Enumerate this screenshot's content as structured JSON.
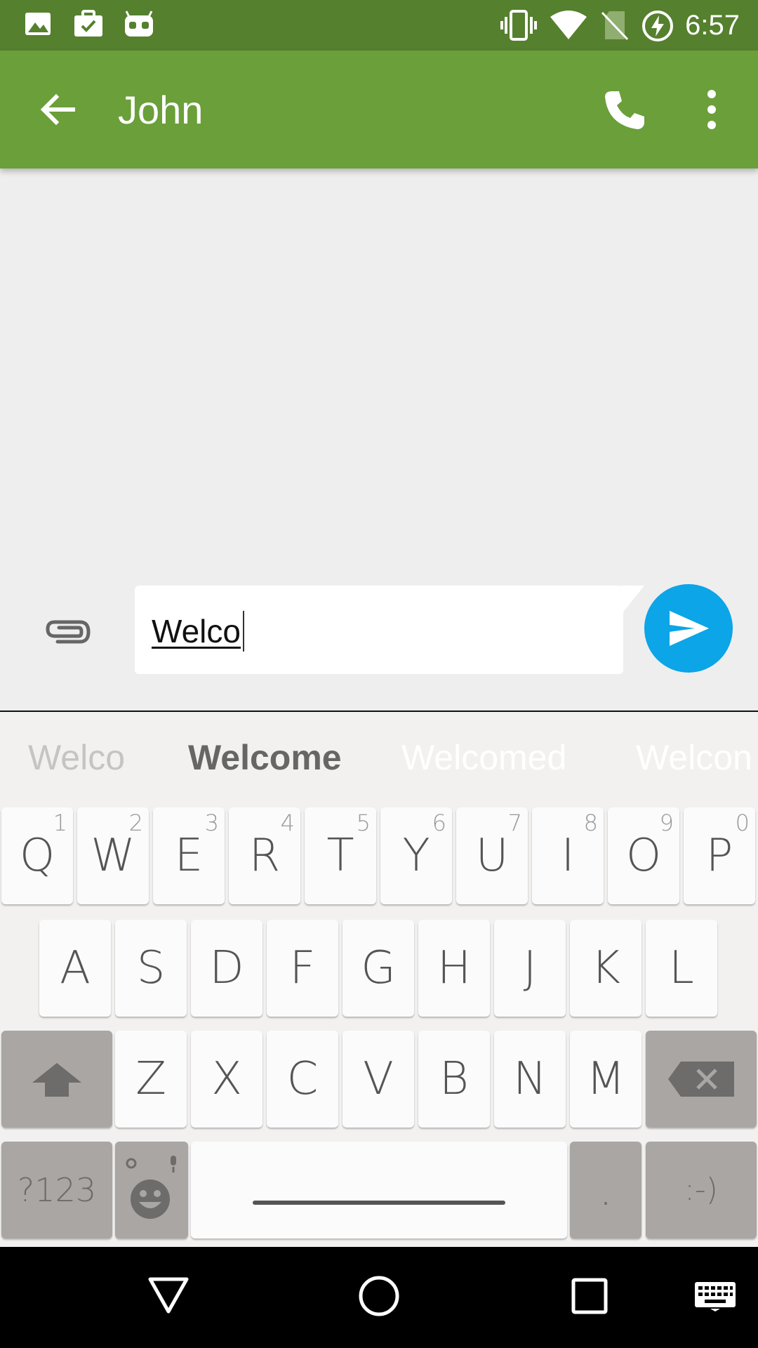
{
  "status_bar": {
    "time": "6:57",
    "left_icons": [
      "image-icon",
      "briefcase-check-icon",
      "cyanogen-icon"
    ],
    "right_icons": [
      "vibrate-icon",
      "wifi-icon",
      "no-sim-icon",
      "battery-charging-icon"
    ]
  },
  "app_bar": {
    "title": "John",
    "back_icon": "arrow-back-icon",
    "call_icon": "phone-icon",
    "more_icon": "more-vert-icon",
    "color": "#6a9f3a"
  },
  "compose": {
    "text": "Welco",
    "attach_icon": "paperclip-icon",
    "send_icon": "send-icon",
    "send_color": "#0ba5e8"
  },
  "keyboard": {
    "suggestions": [
      "Welco",
      "Welcome",
      "Welcomed",
      "Welcon"
    ],
    "row1": [
      {
        "k": "Q",
        "h": "1"
      },
      {
        "k": "W",
        "h": "2"
      },
      {
        "k": "E",
        "h": "3"
      },
      {
        "k": "R",
        "h": "4"
      },
      {
        "k": "T",
        "h": "5"
      },
      {
        "k": "Y",
        "h": "6"
      },
      {
        "k": "U",
        "h": "7"
      },
      {
        "k": "I",
        "h": "8"
      },
      {
        "k": "O",
        "h": "9"
      },
      {
        "k": "P",
        "h": "0"
      }
    ],
    "row2": [
      "A",
      "S",
      "D",
      "F",
      "G",
      "H",
      "J",
      "K",
      "L"
    ],
    "row3": [
      "Z",
      "X",
      "C",
      "V",
      "B",
      "N",
      "M"
    ],
    "symbols_label": "?123",
    "period_label": ".",
    "smiley_label": ":-)"
  },
  "nav_bar": {
    "icons": [
      "back-triangle-icon",
      "home-circle-icon",
      "recents-square-icon",
      "keyboard-icon"
    ]
  }
}
